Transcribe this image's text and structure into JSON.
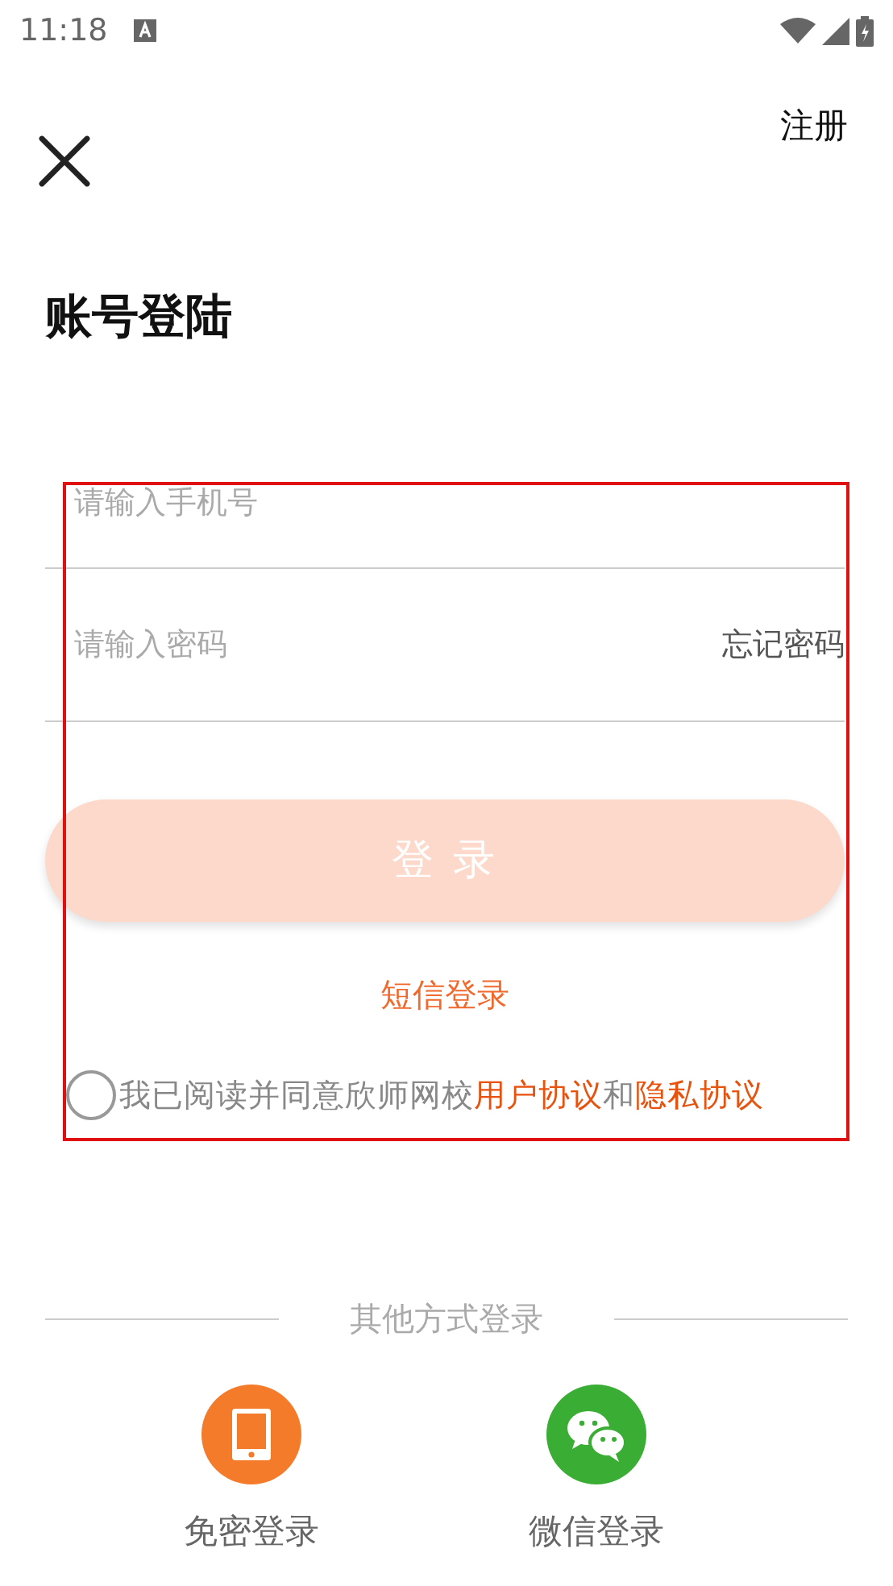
{
  "status_bar": {
    "time": "11:18"
  },
  "header": {
    "register_link": "注册"
  },
  "title": "账号登陆",
  "fields": [
    {
      "placeholder": "请输入手机号"
    },
    {
      "placeholder": "请输入密码",
      "action": "忘记密码"
    }
  ],
  "login_button": {
    "label": "登 录",
    "disabled": true
  },
  "sms_login": "短信登录",
  "agreement": {
    "checked": false,
    "text": "我已阅读并同意欣师网校",
    "links": [
      "用户协议",
      "隐私协议"
    ],
    "joiner": "和"
  },
  "other_login": {
    "heading": "其他方式登录",
    "options": [
      {
        "kind": "phone",
        "label": "免密登录",
        "color": "#f47b2a"
      },
      {
        "kind": "wechat",
        "label": "微信登录",
        "color": "#3aad35"
      }
    ]
  }
}
